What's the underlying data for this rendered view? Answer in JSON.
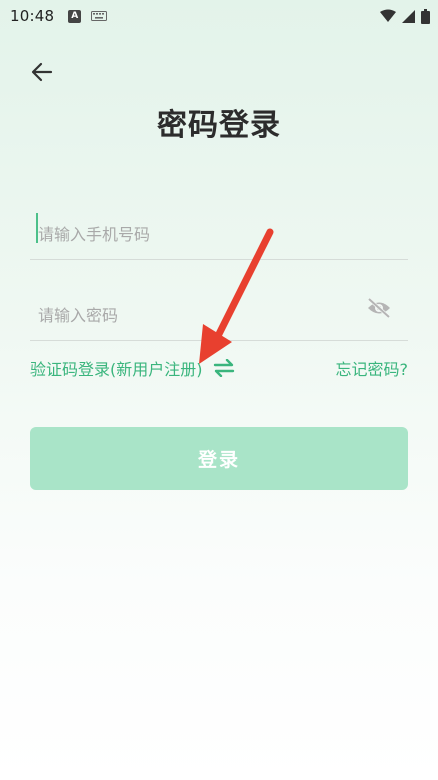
{
  "status_bar": {
    "time": "10:48",
    "icons": [
      "a-notification-icon",
      "keyboard-icon",
      "wifi-icon",
      "signal-icon",
      "battery-icon"
    ]
  },
  "header": {
    "back_icon": "arrow-left-icon",
    "title": "密码登录"
  },
  "form": {
    "phone": {
      "placeholder": "请输入手机号码",
      "value": ""
    },
    "password": {
      "placeholder": "请输入密码",
      "value": "",
      "toggle_icon": "eye-off-icon"
    }
  },
  "links": {
    "sms_login": "验证码登录(新用户注册)",
    "swap_icon": "swap-arrows-icon",
    "forgot_password": "忘记密码?"
  },
  "actions": {
    "login_label": "登录"
  },
  "colors": {
    "accent": "#3ab57d",
    "button_disabled": "#a9e4c8",
    "annotation": "#e8402f"
  }
}
